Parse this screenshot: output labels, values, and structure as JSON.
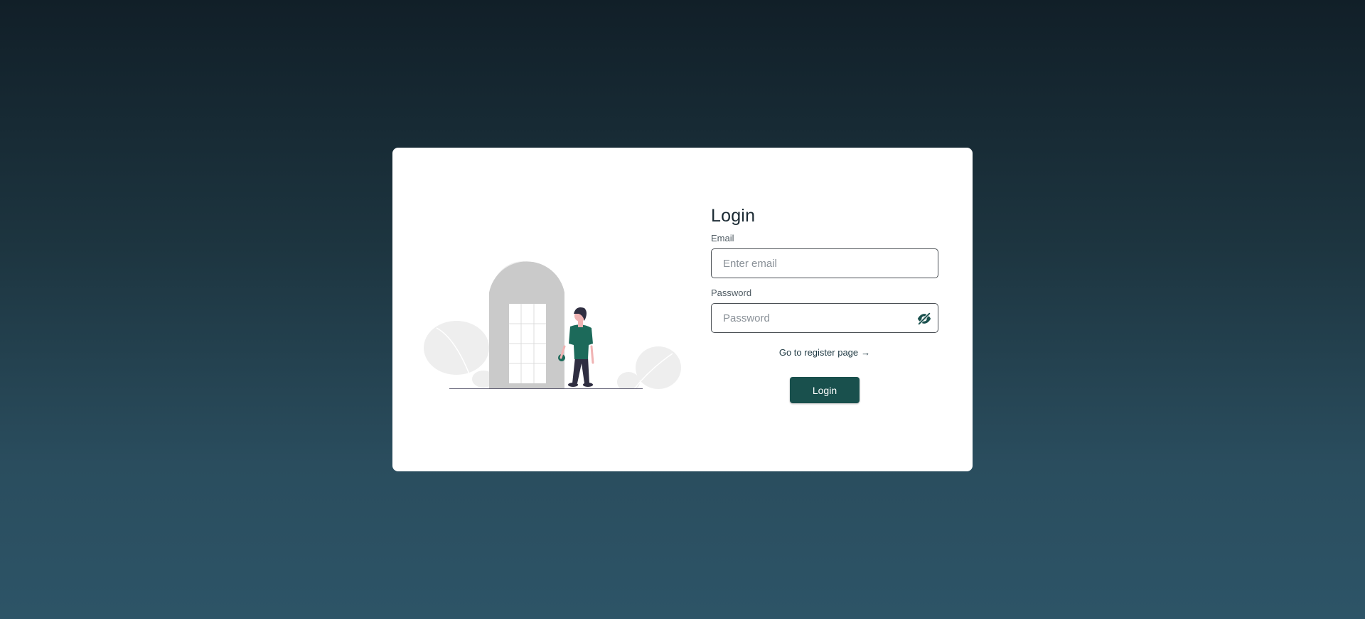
{
  "login": {
    "title": "Login",
    "email_label": "Email",
    "email_placeholder": "Enter email",
    "email_value": "",
    "password_label": "Password",
    "password_placeholder": "Password",
    "password_value": "",
    "register_link": "Go to register page",
    "register_arrow": "→",
    "submit_label": "Login"
  },
  "icons": {
    "password_toggle": "eye-slash-icon",
    "register_arrow": "arrow-right-icon",
    "illustration": "person-at-door-illustration"
  },
  "colors": {
    "accent": "#19504d",
    "shirt": "#1c6a5a",
    "background_top": "#111f28",
    "background_bottom": "#2d5467"
  }
}
